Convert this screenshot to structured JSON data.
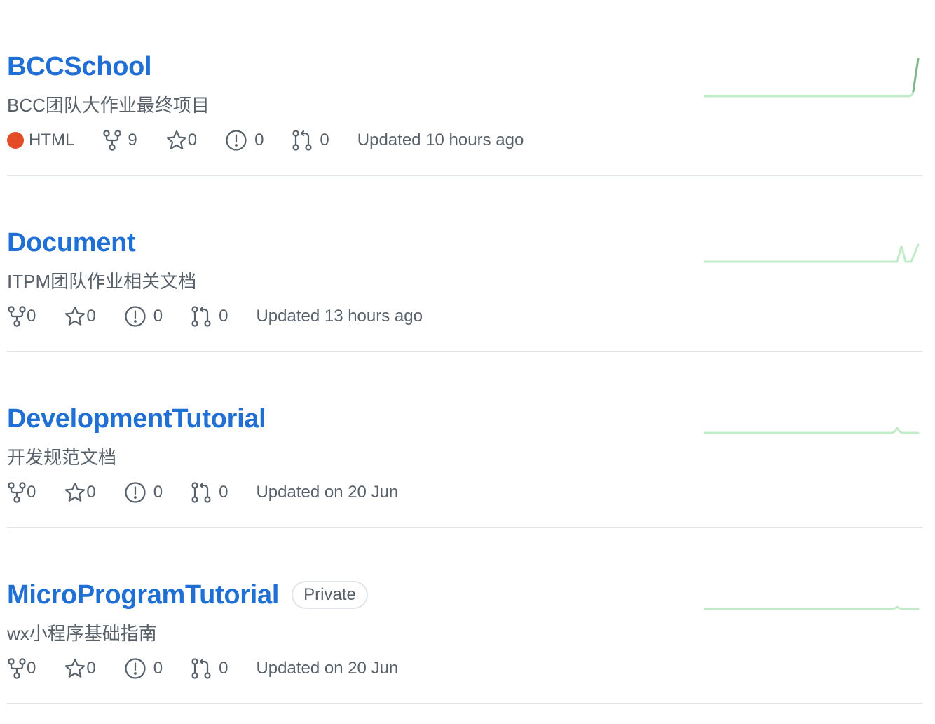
{
  "colors": {
    "link": "#1f6fd4",
    "meta_text": "#586069",
    "sparkline": "#c2ecc9",
    "sparkline_peak": "#7fb68a"
  },
  "icons": [
    "fork-icon",
    "star-icon",
    "issue-icon",
    "pull-request-icon"
  ],
  "repos": [
    {
      "name": "BCCSchool",
      "description": "BCC团队大作业最终项目",
      "language": "HTML",
      "language_color": "#e34c26",
      "forks": "9",
      "stars": "0",
      "issues": "0",
      "pulls": "0",
      "updated": "Updated 10 hours ago"
    },
    {
      "name": "Document",
      "description": "ITPM团队作业相关文档",
      "forks": "0",
      "stars": "0",
      "issues": "0",
      "pulls": "0",
      "updated": "Updated 13 hours ago"
    },
    {
      "name": "DevelopmentTutorial",
      "description": "开发规范文档",
      "forks": "0",
      "stars": "0",
      "issues": "0",
      "pulls": "0",
      "updated": "Updated on 20 Jun"
    },
    {
      "name": "MicroProgramTutorial",
      "private_label": "Private",
      "description": "wx小程序基础指南",
      "forks": "0",
      "stars": "0",
      "issues": "0",
      "pulls": "0",
      "updated": "Updated on 20 Jun"
    }
  ]
}
